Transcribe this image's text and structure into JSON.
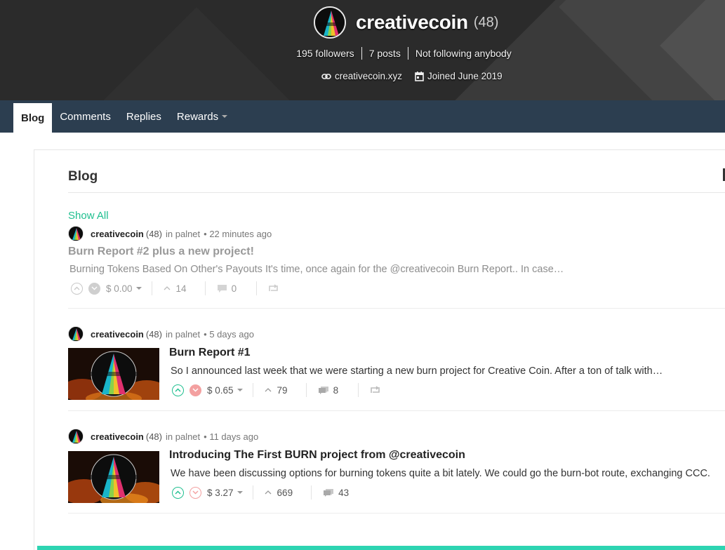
{
  "profile": {
    "name": "creativecoin",
    "reputation": "(48)",
    "followers": "195 followers",
    "posts": "7 posts",
    "following": "Not following anybody",
    "website": "creativecoin.xyz",
    "joined": "Joined June 2019",
    "avatar_icon": "creativecoin-logo-icon"
  },
  "nav": {
    "tabs": [
      {
        "label": "Blog",
        "active": true
      },
      {
        "label": "Comments",
        "active": false
      },
      {
        "label": "Replies",
        "active": false
      },
      {
        "label": "Rewards",
        "active": false,
        "has_dropdown": true
      }
    ]
  },
  "blog": {
    "title": "Blog",
    "show_all": "Show All",
    "posts": [
      {
        "author": "creativecoin",
        "author_rep": "(48)",
        "community": "in palnet",
        "time": "• 22 minutes ago",
        "title": "Burn Report #2 plus a new project!",
        "excerpt": "Burning Tokens Based On Other's Payouts It's time, once again for the @creativecoin Burn Report.. In case…",
        "payout": "$ 0.00",
        "votes": "14",
        "comments": "0",
        "pending": true
      },
      {
        "author": "creativecoin",
        "author_rep": "(48)",
        "community": "in palnet",
        "time": "• 5 days ago",
        "title": "Burn Report #1",
        "excerpt": "So I announced last week that we were starting a new burn project for Creative Coin. After a ton of talk with…",
        "payout": "$ 0.65",
        "votes": "79",
        "comments": "8",
        "has_thumbnail": true
      },
      {
        "author": "creativecoin",
        "author_rep": "(48)",
        "community": "in palnet",
        "time": "• 11 days ago",
        "title": "Introducing The First BURN project from @creativecoin",
        "excerpt": "We have been discussing options for burning tokens quite a bit lately. We could go the burn-bot route, exchanging CCC.",
        "payout": "$ 3.27",
        "votes": "669",
        "comments": "43",
        "has_thumbnail": true
      }
    ]
  },
  "colors": {
    "banner_bg": "#2b2b2b",
    "nav_bg": "#2c3e50",
    "accent_green": "#1fbf8f",
    "downvote_red": "#f3a0a0",
    "bottom_accent": "#2dd4b2"
  }
}
